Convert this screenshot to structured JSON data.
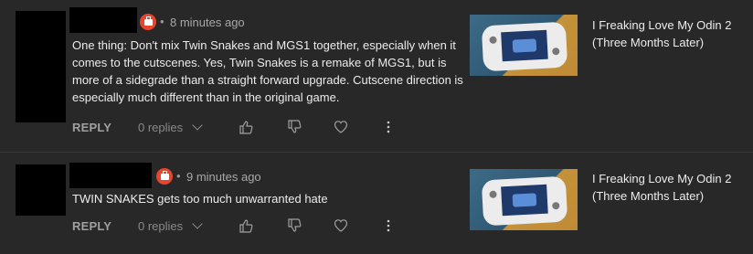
{
  "comments": [
    {
      "time": "8 minutes ago",
      "text": "One thing: Don't mix Twin Snakes and MGS1 together, especially when it comes to the cutscenes. Yes, Twin Snakes is a remake of MGS1, but is more of a sidegrade than a straight forward upgrade. Cutscene direction is especially much different than in the original game.",
      "reply_label": "REPLY",
      "replies_label": "0 replies",
      "video_title": "I Freaking Love My Odin 2 (Three Months Later)"
    },
    {
      "time": "9 minutes ago",
      "text": "TWIN SNAKES gets too much unwarranted hate",
      "reply_label": "REPLY",
      "replies_label": "0 replies",
      "video_title": "I Freaking Love My Odin 2 (Three Months Later)"
    }
  ],
  "separator": "•",
  "colors": {
    "background": "#282828",
    "badge": "#e8452c",
    "text": "#ececec",
    "muted": "#a0a0a0"
  },
  "icons": [
    "toolbox-badge-icon",
    "thumbs-up-icon",
    "thumbs-down-icon",
    "heart-icon",
    "more-vert-icon",
    "chevron-down-icon"
  ]
}
